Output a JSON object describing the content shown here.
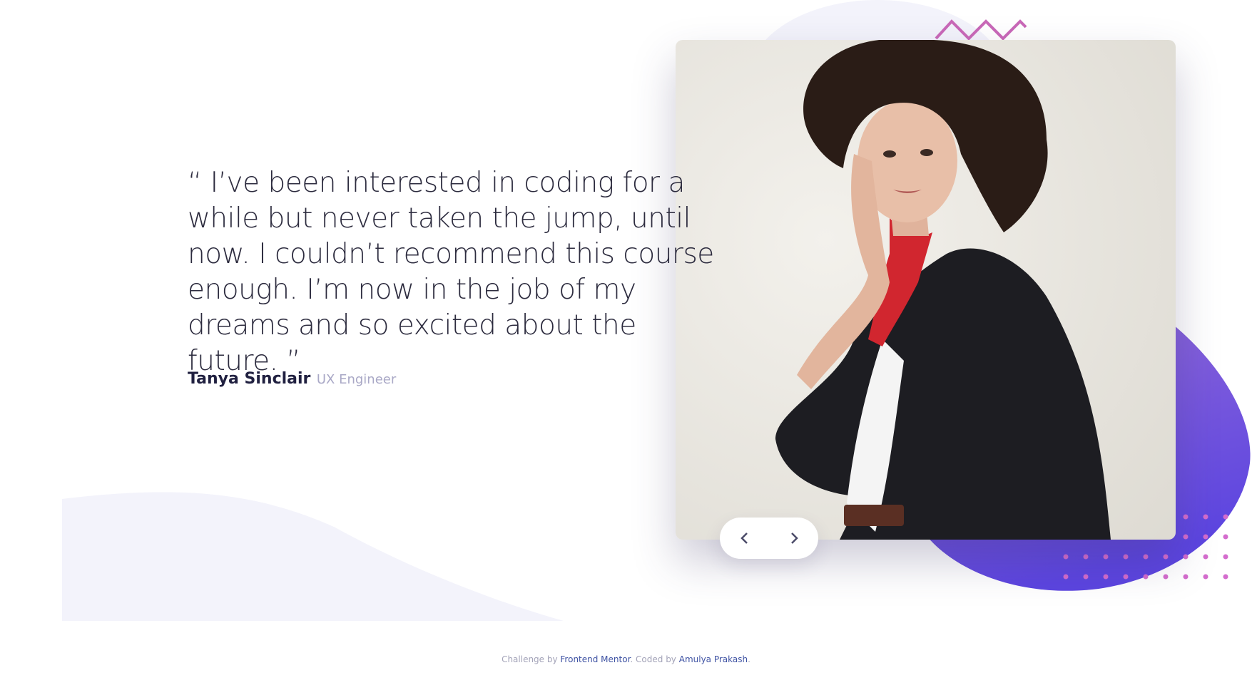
{
  "testimonial": {
    "quote": "“ I’ve been interested in coding for a while but never taken the jump, until now. I couldn’t recommend this course enough. I’m now in the job of my dreams and so excited about the future. ”",
    "name": "Tanya Sinclair",
    "role": "UX Engineer"
  },
  "navigation": {
    "prev_icon": "chevron-left-icon",
    "next_icon": "chevron-right-icon"
  },
  "footer": {
    "prefix": "Challenge by ",
    "challenge_link": "Frontend Mentor",
    "middle": ". Coded by ",
    "author_link": "Amulya Prakash",
    "suffix": "."
  },
  "colors": {
    "text_dark": "#2c2b3e",
    "name": "#202040",
    "role": "#a9a8c6",
    "blob_start": "#8a5ad6",
    "blob_end": "#5e46e0",
    "dots": "#d46ccd",
    "zigzag": "#c968b8",
    "curve_bg": "#f3f3fb",
    "link": "#3e52a3"
  }
}
